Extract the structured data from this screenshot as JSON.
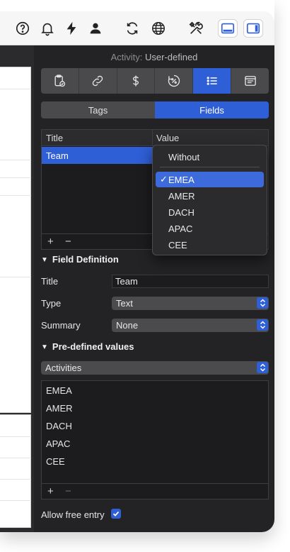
{
  "toolbar": {
    "icons": [
      "help-icon",
      "bell-icon",
      "bolt-icon",
      "person-icon",
      "sync-icon",
      "globe-icon",
      "tools-icon",
      "bottom-panel-icon",
      "right-panel-icon"
    ]
  },
  "inspector": {
    "activity_prefix": "Activity:",
    "activity_name": "User-defined",
    "tabs": [
      "clipboard-check-icon",
      "link-icon",
      "dollar-icon",
      "percent-timer-icon",
      "list-icon",
      "window-icon"
    ],
    "segments": {
      "tags": "Tags",
      "fields": "Fields"
    }
  },
  "fields_table": {
    "columns": {
      "title": "Title",
      "value": "Value"
    },
    "rows": [
      {
        "title": "Team"
      }
    ],
    "add_label": "+",
    "remove_label": "−"
  },
  "value_menu": {
    "items": [
      "Without",
      "EMEA",
      "AMER",
      "DACH",
      "APAC",
      "CEE"
    ],
    "check_mark": "✓",
    "selected": "EMEA"
  },
  "field_definition": {
    "heading": "Field Definition",
    "title_label": "Title",
    "title_value": "Team",
    "type_label": "Type",
    "type_value": "Text",
    "summary_label": "Summary",
    "summary_value": "None"
  },
  "predefined": {
    "heading": "Pre-defined values",
    "source_value": "Activities",
    "values": [
      "EMEA",
      "AMER",
      "DACH",
      "APAC",
      "CEE"
    ],
    "add_label": "+",
    "remove_label": "−"
  },
  "free_entry": {
    "label": "Allow free entry",
    "checked": true
  },
  "colors": {
    "accent": "#2f5fd6",
    "panel_bg": "#232325"
  }
}
